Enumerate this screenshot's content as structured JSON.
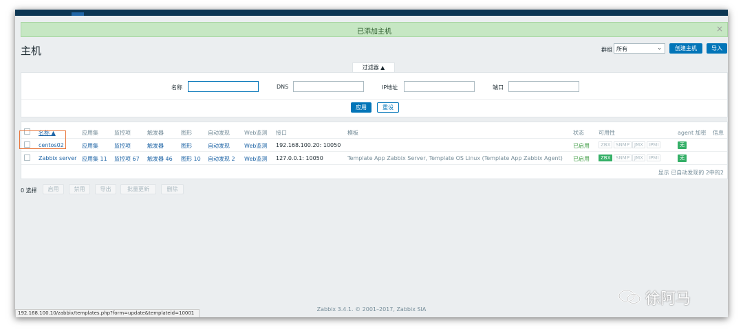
{
  "notification": {
    "message": "已添加主机",
    "close": "×"
  },
  "header": {
    "title": "主机",
    "group_label": "群组",
    "group_value": "所有",
    "create_button": "创建主机",
    "import_button": "导入"
  },
  "filter": {
    "tab_label": "过滤器 ▲",
    "name_label": "名称",
    "dns_label": "DNS",
    "ip_label": "IP地址",
    "port_label": "端口",
    "name_value": "",
    "dns_value": "",
    "ip_value": "",
    "port_value": "",
    "apply_button": "应用",
    "reset_button": "重设"
  },
  "table": {
    "columns": {
      "name": "名称 ▲",
      "applications": "应用集",
      "items": "监控项",
      "triggers": "触发器",
      "graphs": "图形",
      "discovery": "自动发现",
      "web": "Web监测",
      "interface": "接口",
      "templates": "模板",
      "status": "状态",
      "availability": "可用性",
      "encryption": "agent 加密",
      "info": "信息"
    },
    "rows": [
      {
        "name": "centos02",
        "applications": "应用集",
        "items": "监控项",
        "triggers": "触发器",
        "graphs": "图形",
        "discovery": "自动发现",
        "web": "Web监测",
        "interface": "192.168.100.20: 10050",
        "templates": "",
        "status": "已启用",
        "avail": [
          "ZBX",
          "SNMP",
          "JMX",
          "IPMI"
        ],
        "encryption": "无"
      },
      {
        "name": "Zabbix server",
        "applications": "应用集 11",
        "items": "监控项 67",
        "triggers": "触发器 46",
        "graphs": "图形 10",
        "discovery": "自动发现 2",
        "web": "Web监测",
        "interface": "127.0.0.1: 10050",
        "templates": "Template App Zabbix Server, Template OS Linux (Template App Zabbix Agent)",
        "status": "已启用",
        "avail": [
          "ZBX",
          "SNMP",
          "JMX",
          "IPMI"
        ],
        "encryption": "无"
      }
    ],
    "summary": "显示 已自动发现的 2中的2"
  },
  "actions": {
    "selected": "0 选择",
    "enable": "启用",
    "disable": "禁用",
    "export": "导出",
    "mass_update": "批量更新",
    "delete": "删除"
  },
  "footer": {
    "copyright": "Zabbix 3.4.1. © 2001–2017, Zabbix SIA"
  },
  "statusbar": {
    "url": "192.168.100.10/zabbix/templates.php?form=update&templateid=10001"
  },
  "watermark": {
    "text": "徐阿马"
  },
  "colors": {
    "accent": "#0275b8",
    "success": "#34af67",
    "header_bg": "#0c3653",
    "highlight": "#e8753a"
  }
}
